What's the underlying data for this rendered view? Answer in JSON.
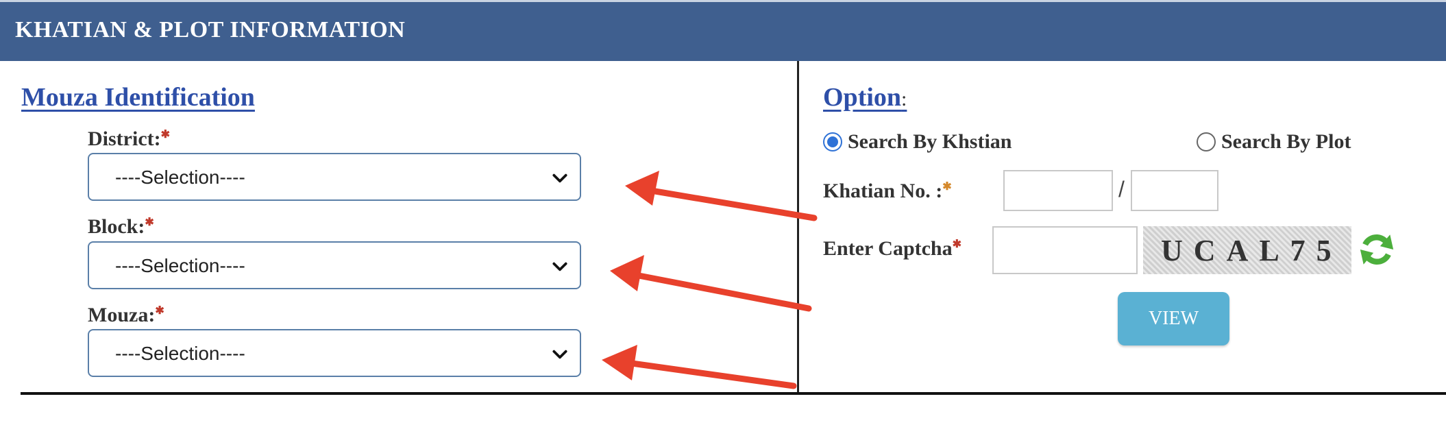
{
  "header": {
    "title": "KHATIAN & PLOT INFORMATION"
  },
  "left": {
    "section_title": "Mouza Identification",
    "district": {
      "label": "District:",
      "value": "----Selection----"
    },
    "block": {
      "label": "Block:",
      "value": "----Selection----"
    },
    "mouza": {
      "label": "Mouza:",
      "value": "----Selection----"
    }
  },
  "right": {
    "section_title": "Option",
    "section_colon": ":",
    "radio_khatian": "Search By Khstian",
    "radio_plot": "Search By Plot",
    "selected_option": "khatian",
    "khatian_label": "Khatian No. :",
    "khatian_separator": "/",
    "captcha_label": "Enter Captcha",
    "captcha_text": "UCAL75",
    "view_button": "VIEW"
  },
  "colors": {
    "header_bg": "#3f5f8f",
    "accent_blue": "#2e4fa8",
    "view_button_bg": "#5ab1d3",
    "arrow": "#e8412c",
    "refresh_icon": "#4caf3c"
  },
  "icons": [
    "chevron-down-icon",
    "refresh-icon",
    "arrow-icon"
  ]
}
